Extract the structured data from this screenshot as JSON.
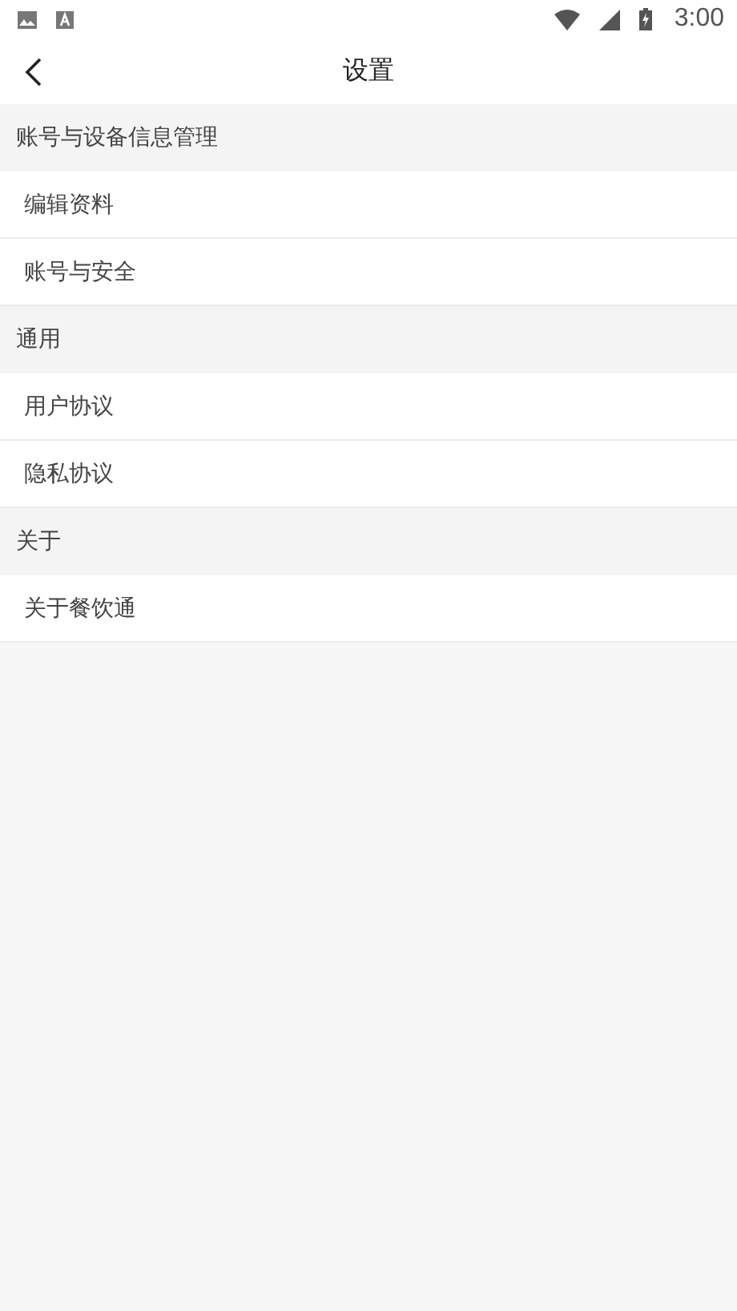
{
  "status_bar": {
    "time": "3:00"
  },
  "header": {
    "title": "设置"
  },
  "sections": [
    {
      "title": "账号与设备信息管理",
      "items": [
        "编辑资料",
        "账号与安全"
      ]
    },
    {
      "title": "通用",
      "items": [
        "用户协议",
        "隐私协议"
      ]
    },
    {
      "title": "关于",
      "items": [
        "关于餐饮通"
      ]
    }
  ]
}
